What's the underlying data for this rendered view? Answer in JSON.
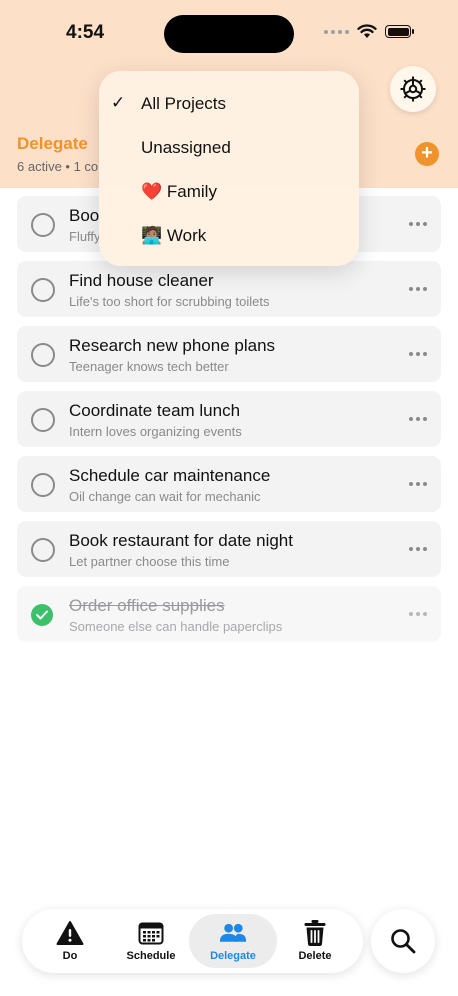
{
  "status_bar": {
    "time": "4:54"
  },
  "header": {
    "section_title": "Delegate",
    "section_subtitle": "6 active • 1 co",
    "add_label": "+"
  },
  "project_menu": {
    "items": [
      {
        "label": "All Projects",
        "checked": true,
        "check_glyph": "✓",
        "emoji": ""
      },
      {
        "label": "Unassigned",
        "checked": false,
        "emoji": ""
      },
      {
        "label": "Family",
        "checked": false,
        "emoji": "❤️"
      },
      {
        "label": "Work",
        "checked": false,
        "emoji": "🧑🏽‍💻"
      }
    ]
  },
  "tasks": [
    {
      "title": "Boo",
      "subtitle": "Fluffy",
      "done": false
    },
    {
      "title": "Find house cleaner",
      "subtitle": "Life's too short for scrubbing toilets",
      "done": false
    },
    {
      "title": "Research new phone plans",
      "subtitle": "Teenager knows tech better",
      "done": false
    },
    {
      "title": "Coordinate team lunch",
      "subtitle": "Intern loves organizing events",
      "done": false
    },
    {
      "title": "Schedule car maintenance",
      "subtitle": "Oil change can wait for mechanic",
      "done": false
    },
    {
      "title": "Book restaurant for date night",
      "subtitle": "Let partner choose this time",
      "done": false
    },
    {
      "title": "Order office supplies",
      "subtitle": "Someone else can handle paperclips",
      "done": true
    }
  ],
  "tabbar": {
    "tabs": [
      {
        "label": "Do",
        "icon": "warning-icon",
        "active": false
      },
      {
        "label": "Schedule",
        "icon": "calendar-icon",
        "active": false
      },
      {
        "label": "Delegate",
        "icon": "people-icon",
        "active": true
      },
      {
        "label": "Delete",
        "icon": "trash-icon",
        "active": false
      }
    ]
  },
  "colors": {
    "header_bg": "#fde0c8",
    "accent_orange": "#f0932b",
    "active_blue": "#1e88e5",
    "done_green": "#3cc06a"
  }
}
